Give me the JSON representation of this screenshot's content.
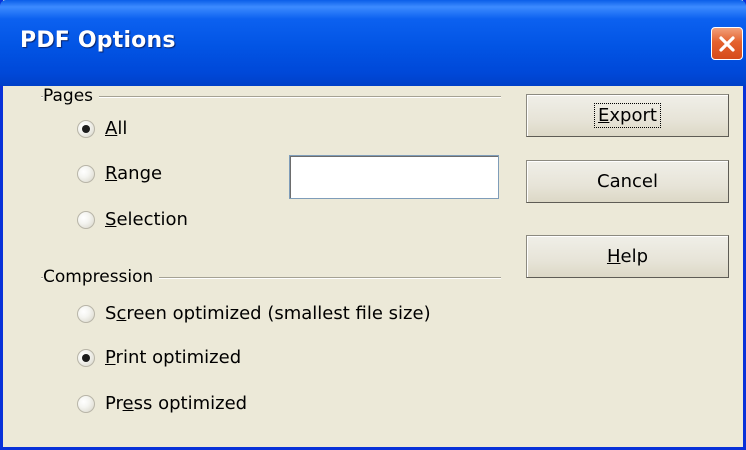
{
  "window": {
    "title": "PDF Options"
  },
  "pages_group": {
    "label": "Pages",
    "options": [
      {
        "pre": "",
        "mnemonic": "A",
        "post": "ll",
        "checked": true
      },
      {
        "pre": "",
        "mnemonic": "R",
        "post": "ange",
        "checked": false
      },
      {
        "pre": "",
        "mnemonic": "S",
        "post": "election",
        "checked": false
      }
    ],
    "range_value": ""
  },
  "compression_group": {
    "label": "Compression",
    "options": [
      {
        "pre": "S",
        "mnemonic": "c",
        "post": "reen optimized (smallest file size)",
        "checked": false
      },
      {
        "pre": "",
        "mnemonic": "P",
        "post": "rint optimized",
        "checked": true
      },
      {
        "pre": "Pr",
        "mnemonic": "e",
        "post": "ss optimized",
        "checked": false
      }
    ]
  },
  "buttons": {
    "export": {
      "pre": "",
      "mnemonic": "E",
      "post": "xport"
    },
    "cancel": {
      "label": "Cancel"
    },
    "help": {
      "pre": "",
      "mnemonic": "H",
      "post": "elp"
    }
  },
  "colors": {
    "titlebar": "#0254e4",
    "dialog_bg": "#ece9d8",
    "close_button": "#e4622e"
  }
}
